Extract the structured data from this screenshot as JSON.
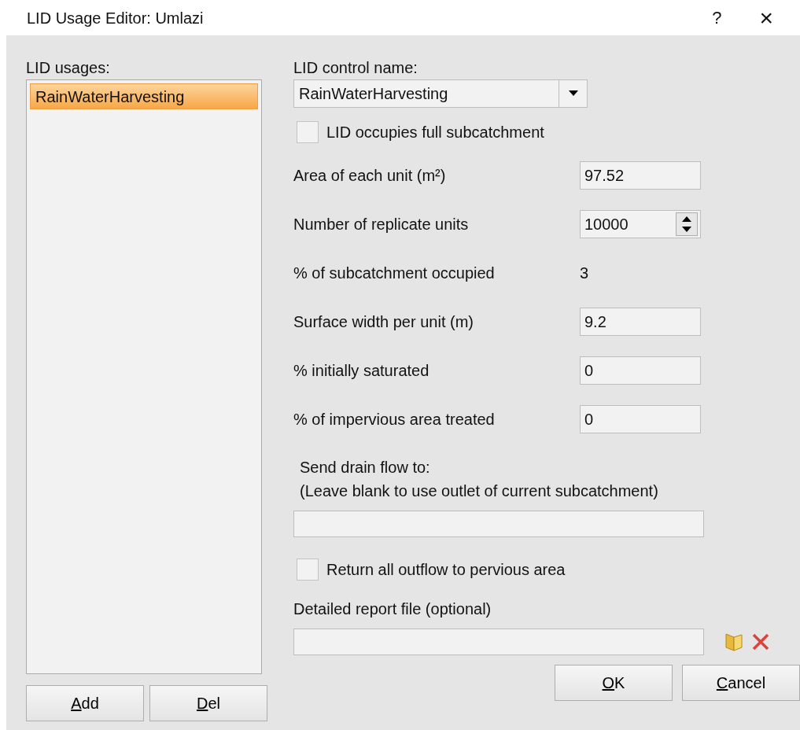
{
  "window": {
    "title": "LID Usage Editor: Umlazi",
    "help": "?",
    "close": "×"
  },
  "usages": {
    "label": "LID usages:",
    "items": [
      {
        "name": "RainWaterHarvesting",
        "selected": true
      }
    ]
  },
  "control": {
    "label": "LID control name:",
    "value": "RainWaterHarvesting"
  },
  "full_subcatchment": {
    "label": "LID occupies full subcatchment",
    "checked": false
  },
  "fields": [
    {
      "kind": "text",
      "label": "Area of each unit (m²)",
      "value": "97.52"
    },
    {
      "kind": "spin",
      "label": "Number of replicate units",
      "value": "10000"
    },
    {
      "kind": "readout",
      "label": "% of subcatchment occupied",
      "value": "3"
    },
    {
      "kind": "text",
      "label": "Surface width per unit (m)",
      "value": "9.2"
    },
    {
      "kind": "text",
      "label": "% initially saturated",
      "value": "0"
    },
    {
      "kind": "text",
      "label": "% of impervious area treated",
      "value": "0"
    }
  ],
  "drain": {
    "label": "Send drain flow to:",
    "hint": "(Leave blank to use outlet of current subcatchment)"
  },
  "return_outflow": {
    "label": "Return all outflow to pervious area",
    "checked": false
  },
  "report": {
    "label": "Detailed report file (optional)"
  },
  "buttons": {
    "left": [
      "Add",
      "Del"
    ],
    "right": [
      "OK",
      "Cancel"
    ]
  }
}
